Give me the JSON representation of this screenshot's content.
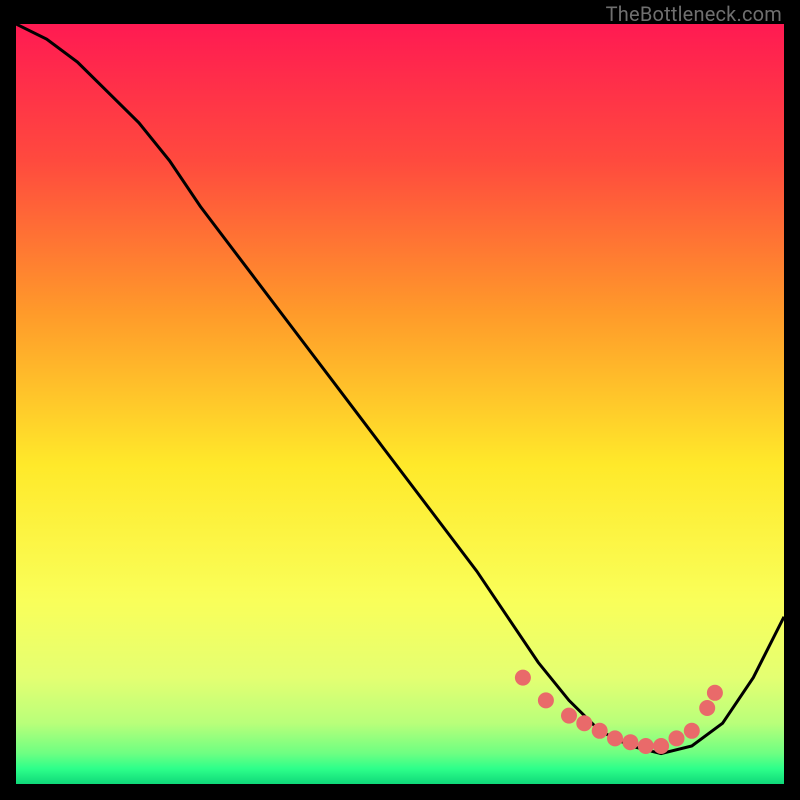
{
  "watermark": "TheBottleneck.com",
  "colors": {
    "top": "#ff1a52",
    "mid_upper": "#ff8a2a",
    "mid": "#ffe92a",
    "mid_lower": "#f4ff6a",
    "green_light": "#b9ff7a",
    "green": "#2dff8a",
    "green_dark": "#0fd879",
    "curve": "#000000",
    "dot": "#e96a6a",
    "bg": "#000000"
  },
  "chart_data": {
    "type": "line",
    "title": "",
    "xlabel": "",
    "ylabel": "",
    "xlim": [
      0,
      100
    ],
    "ylim": [
      0,
      100
    ],
    "series": [
      {
        "name": "bottleneck-curve",
        "x": [
          0,
          4,
          8,
          12,
          16,
          20,
          24,
          30,
          36,
          42,
          48,
          54,
          60,
          64,
          68,
          72,
          76,
          80,
          84,
          88,
          92,
          96,
          100
        ],
        "y": [
          100,
          98,
          95,
          91,
          87,
          82,
          76,
          68,
          60,
          52,
          44,
          36,
          28,
          22,
          16,
          11,
          7,
          5,
          4,
          5,
          8,
          14,
          22
        ]
      }
    ],
    "markers": {
      "name": "optimal-range-dots",
      "x": [
        66,
        69,
        72,
        74,
        76,
        78,
        80,
        82,
        84,
        86,
        88,
        90,
        91
      ],
      "y": [
        14,
        11,
        9,
        8,
        7,
        6,
        5.5,
        5,
        5,
        6,
        7,
        10,
        12
      ]
    },
    "gradient_stops": [
      {
        "offset": 0,
        "color": "#ff1a52"
      },
      {
        "offset": 18,
        "color": "#ff4a3e"
      },
      {
        "offset": 38,
        "color": "#ff9a2a"
      },
      {
        "offset": 58,
        "color": "#ffe92a"
      },
      {
        "offset": 76,
        "color": "#f9ff5a"
      },
      {
        "offset": 86,
        "color": "#e4ff72"
      },
      {
        "offset": 92,
        "color": "#b9ff7a"
      },
      {
        "offset": 96,
        "color": "#6dff82"
      },
      {
        "offset": 98,
        "color": "#2dff8a"
      },
      {
        "offset": 100,
        "color": "#0fd879"
      }
    ]
  }
}
